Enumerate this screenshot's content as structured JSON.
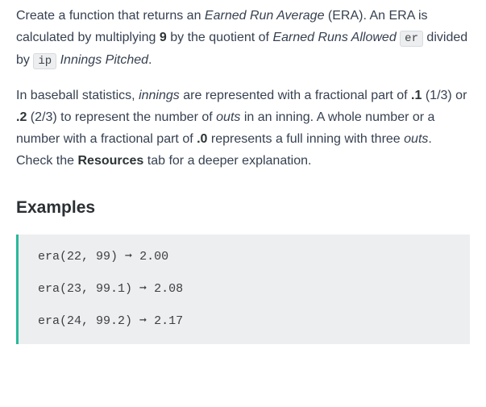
{
  "intro": {
    "t1": "Create a function that returns an ",
    "t2_em": "Earned Run Average",
    "t3": " (ERA). An ERA is calculated by multiplying ",
    "t4_strong": "9",
    "t5": " by the quotient of ",
    "t6_em": "Earned Runs Allowed",
    "t7": " ",
    "t8_code": "er",
    "t9": " divided by ",
    "t10_code": "ip",
    "t11": " ",
    "t12_em": "Innings Pitched",
    "t13": "."
  },
  "para2": {
    "t1": "In baseball statistics, ",
    "t2_em": "innings",
    "t3": " are represented with a fractional part of ",
    "t4_strong": ".1",
    "t5": " (1/3) or ",
    "t6_strong": ".2",
    "t7": " (2/3) to represent the number of ",
    "t8_em": "outs",
    "t9": " in an inning. A whole number or a number with a fractional part of ",
    "t10_strong": ".0",
    "t11": " represents a full inning with three ",
    "t12_em": "outs",
    "t13": ". Check the ",
    "t14_strong": "Resources",
    "t15": " tab for a deeper explanation."
  },
  "examples_heading": "Examples",
  "code": {
    "rows": [
      {
        "call": "era(22, 99)",
        "arrow": "➞",
        "result": "2.00"
      },
      {
        "call": "era(23, 99.1)",
        "arrow": "➞",
        "result": "2.08"
      },
      {
        "call": "era(24, 99.2)",
        "arrow": "➞",
        "result": "2.17"
      }
    ]
  }
}
